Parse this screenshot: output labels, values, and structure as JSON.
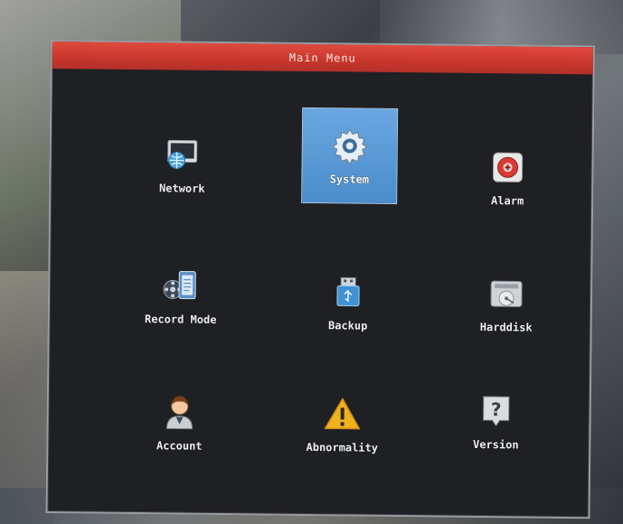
{
  "window": {
    "title": "Main Menu"
  },
  "menu": {
    "items": [
      {
        "label": "Network",
        "icon": "network-icon",
        "selected": false
      },
      {
        "label": "System",
        "icon": "gear-icon",
        "selected": true
      },
      {
        "label": "Alarm",
        "icon": "alarm-icon",
        "selected": false
      },
      {
        "label": "Record Mode",
        "icon": "record-mode-icon",
        "selected": false
      },
      {
        "label": "Backup",
        "icon": "usb-drive-icon",
        "selected": false
      },
      {
        "label": "Harddisk",
        "icon": "harddisk-icon",
        "selected": false
      },
      {
        "label": "Account",
        "icon": "user-icon",
        "selected": false
      },
      {
        "label": "Abnormality",
        "icon": "warning-icon",
        "selected": false
      },
      {
        "label": "Version",
        "icon": "question-icon",
        "selected": false
      }
    ]
  },
  "colors": {
    "title_bar": "#c8362c",
    "selection": "#4b8ccc",
    "menu_background": "#1f2023"
  }
}
